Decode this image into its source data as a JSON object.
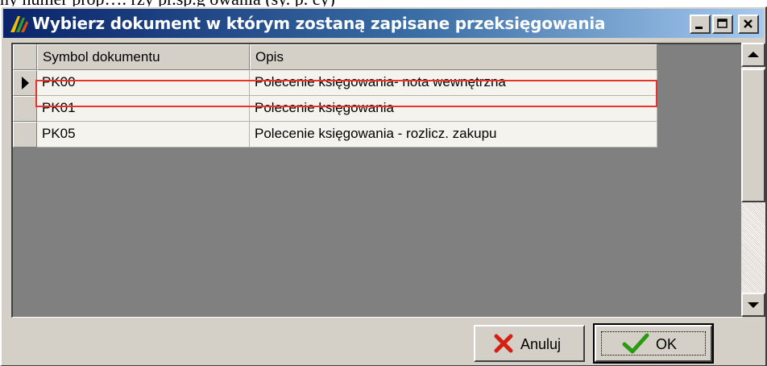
{
  "background_text": "ny numer prop….    rzy pr.sp.g owania (sy.   p.   cy)",
  "window": {
    "title": "Wybierz dokument w którym zostaną zapisane przeksięgowania"
  },
  "grid": {
    "columns": [
      "Symbol dokumentu",
      "Opis"
    ],
    "rows": [
      {
        "symbol": "PK00",
        "opis": "Polecenie księgowania- nota wewnętrzna",
        "selected": true
      },
      {
        "symbol": "PK01",
        "opis": "Polecenie księgowania",
        "selected": false
      },
      {
        "symbol": "PK05",
        "opis": "Polecenie księgowania - rozlicz. zakupu",
        "selected": false
      }
    ]
  },
  "buttons": {
    "cancel_label": "Anuluj",
    "ok_label": "OK"
  },
  "icons": [
    "app-icon",
    "minimize-icon",
    "maximize-icon",
    "close-icon",
    "row-pointer-icon",
    "scroll-up-icon",
    "scroll-down-icon",
    "cancel-x-icon",
    "ok-check-icon"
  ],
  "colors": {
    "titlebar_start": "#0a246a",
    "titlebar_end": "#a6caf0",
    "selection_border": "#e8322c",
    "cancel_icon": "#d42010",
    "ok_icon": "#2a9a10"
  }
}
